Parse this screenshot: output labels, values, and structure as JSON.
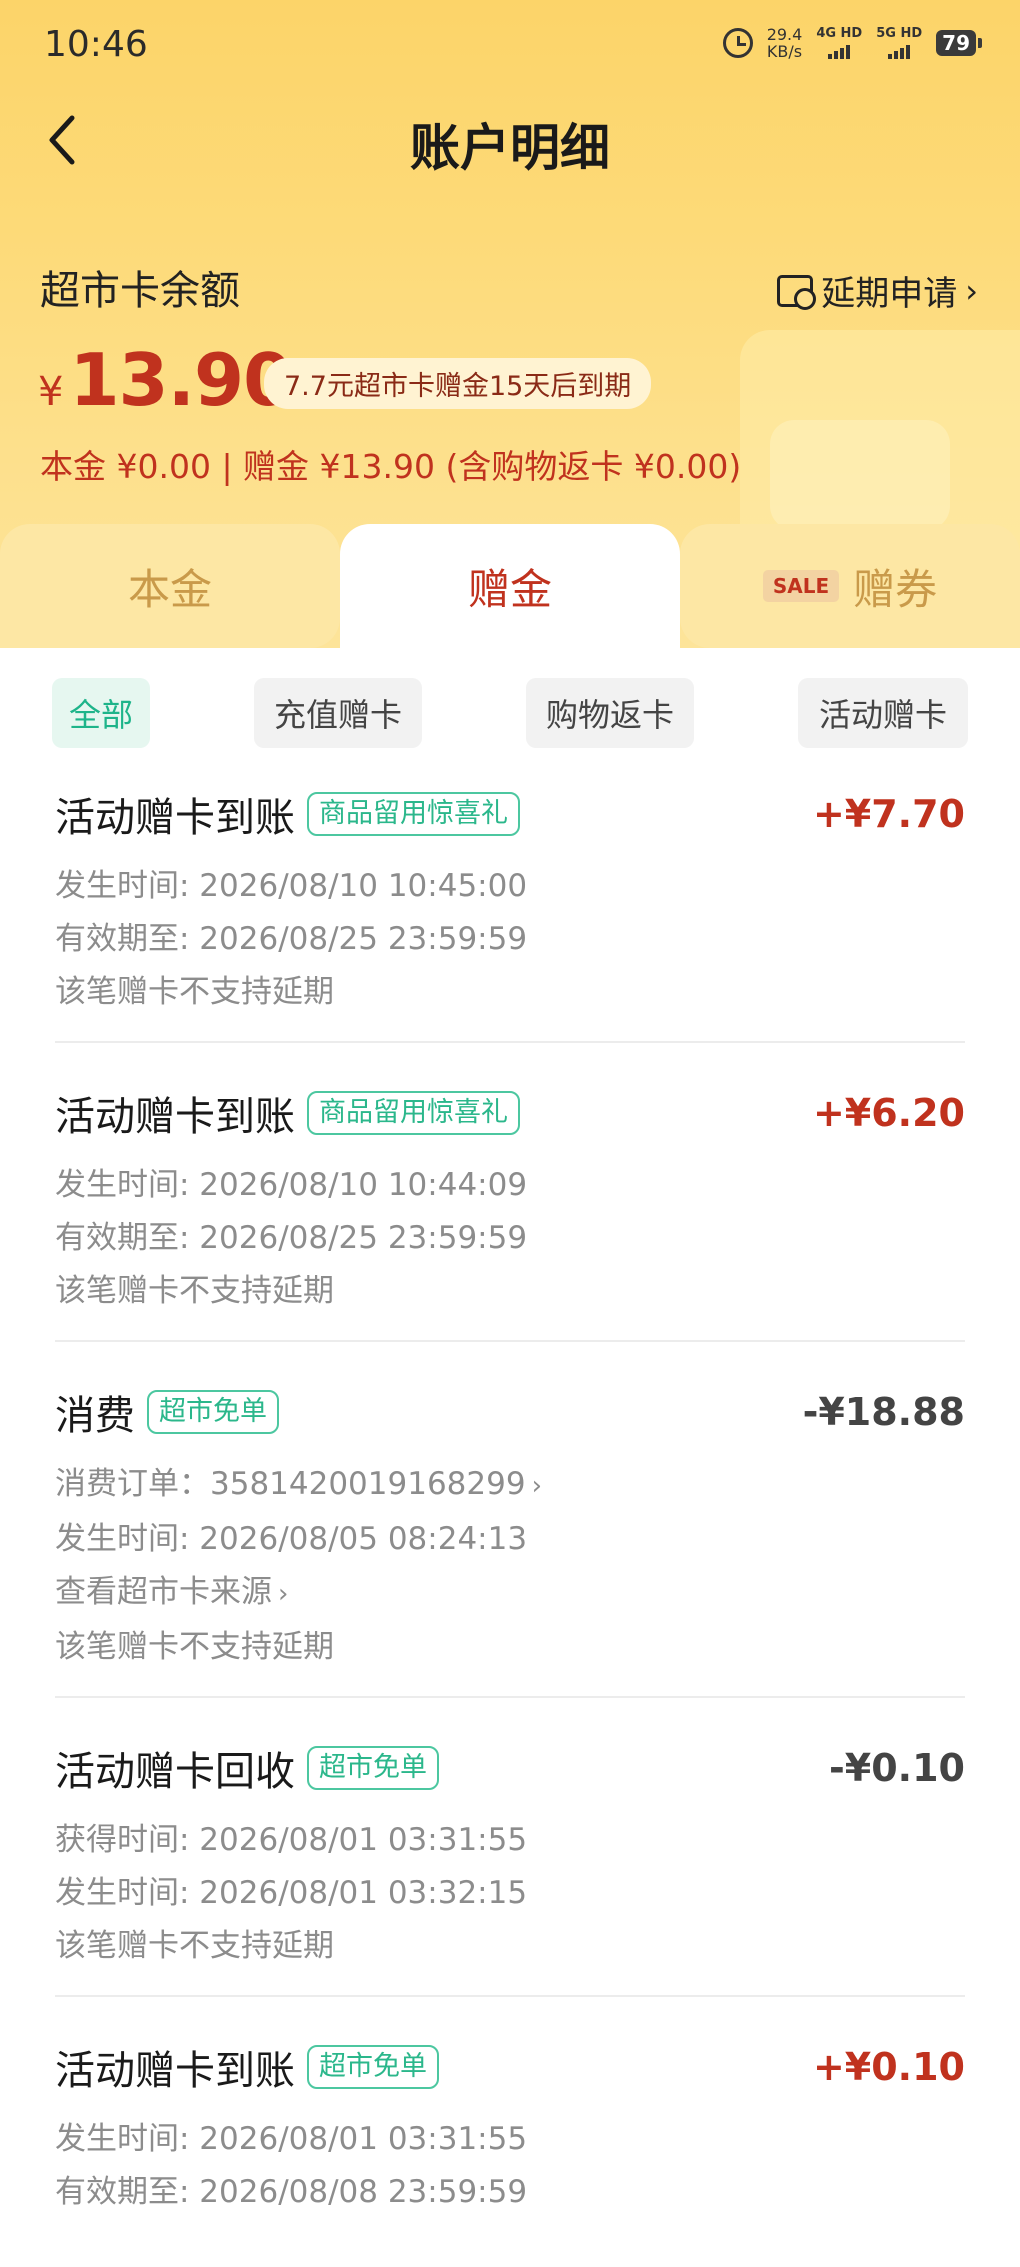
{
  "status": {
    "time": "10:46",
    "speed_value": "29.4",
    "speed_unit": "KB/s",
    "sim1_label": "4G HD",
    "sim2_label": "5G HD",
    "battery": "79"
  },
  "nav": {
    "title": "账户明细"
  },
  "balance": {
    "label": "超市卡余额",
    "extend_label": "延期申请",
    "currency": "¥",
    "amount": "13.90",
    "expire_tip": "7.7元超市卡赠金15天后到期",
    "breakdown": "本金 ¥0.00 | 赠金 ¥13.90 (含购物返卡 ¥0.00)"
  },
  "tabs": [
    {
      "label": "本金"
    },
    {
      "label": "赠金"
    },
    {
      "badge": "SALE",
      "label": "赠券"
    }
  ],
  "filters": [
    {
      "label": "全部",
      "active": true
    },
    {
      "label": "充值赠卡",
      "active": false
    },
    {
      "label": "购物返卡",
      "active": false
    },
    {
      "label": "活动赠卡",
      "active": false
    }
  ],
  "records": [
    {
      "title": "活动赠卡到账",
      "tag": "商品留用惊喜礼",
      "amount": "+¥7.70",
      "lines": [
        "发生时间: 2026/08/10 10:45:00",
        "有效期至: 2026/08/25 23:59:59",
        "该笔赠卡不支持延期"
      ]
    },
    {
      "title": "活动赠卡到账",
      "tag": "商品留用惊喜礼",
      "amount": "+¥6.20",
      "lines": [
        "发生时间: 2026/08/10 10:44:09",
        "有效期至: 2026/08/25 23:59:59",
        "该笔赠卡不支持延期"
      ]
    },
    {
      "title": "消费",
      "tag": "超市免单",
      "amount": "-¥18.88",
      "lines": [
        "消费订单：3581420019168299",
        "发生时间: 2026/08/05 08:24:13",
        "查看超市卡来源",
        "该笔赠卡不支持延期"
      ]
    },
    {
      "title": "活动赠卡回收",
      "tag": "超市免单",
      "amount": "-¥0.10",
      "lines": [
        "获得时间: 2026/08/01 03:31:55",
        "发生时间: 2026/08/01 03:32:15",
        "该笔赠卡不支持延期"
      ]
    },
    {
      "title": "活动赠卡到账",
      "tag": "超市免单",
      "amount": "+¥0.10",
      "lines": [
        "发生时间: 2026/08/01 03:31:55",
        "有效期至: 2026/08/08 23:59:59"
      ]
    }
  ],
  "colors": {
    "accent_red": "#c0321e",
    "tag_green": "#2bb78b",
    "header_yellow": "#fcd469"
  }
}
